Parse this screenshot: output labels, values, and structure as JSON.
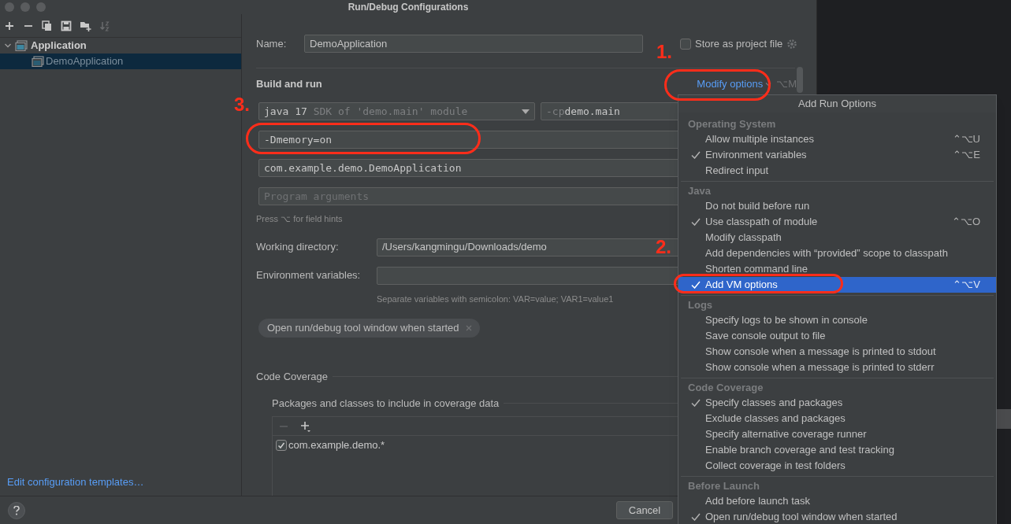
{
  "window": {
    "title": "Run/Debug Configurations"
  },
  "sidebar": {
    "tree": [
      {
        "label": "Application",
        "expanded": true,
        "selected": false,
        "children": [
          {
            "label": "DemoApplication",
            "selected": false,
            "highlighted": true
          }
        ]
      }
    ],
    "footer_link": "Edit configuration templates…"
  },
  "form": {
    "name_label": "Name:",
    "name_value": "DemoApplication",
    "store_as_project_file": {
      "label": "Store as project file",
      "checked": false
    },
    "section_title": "Build and run",
    "modify_options": {
      "label": "Modify options",
      "shortcut": "⌥M"
    },
    "jre": {
      "value": "java 17",
      "hint": "SDK of 'demo.main' module"
    },
    "classpath": {
      "prefix": "-cp",
      "value": "demo.main"
    },
    "vm_options": "-Dmemory=on",
    "main_class": "com.example.demo.DemoApplication",
    "program_arguments": {
      "placeholder": "Program arguments"
    },
    "field_hint": "Press ⌥ for field hints",
    "working_directory": {
      "label": "Working directory:",
      "value": "/Users/kangmingu/Downloads/demo"
    },
    "environment_variables": {
      "label": "Environment variables:",
      "hint": "Separate variables with semicolon: VAR=value; VAR1=value1"
    },
    "chips": [
      {
        "label": "Open run/debug tool window when started"
      }
    ],
    "code_coverage": {
      "title": "Code Coverage",
      "subtitle": "Packages and classes to include in coverage data",
      "patterns": [
        {
          "label": "com.example.demo.*",
          "checked": true
        }
      ]
    },
    "buttons": [
      {
        "label": "Cancel"
      }
    ]
  },
  "popup": {
    "title": "Add Run Options",
    "sections": [
      {
        "title": "Operating System",
        "items": [
          {
            "label": "Allow multiple instances",
            "checked": false,
            "selected": false,
            "shortcut": "⌃⌥U"
          },
          {
            "label": "Environment variables",
            "checked": true,
            "selected": false,
            "shortcut": "⌃⌥E"
          },
          {
            "label": "Redirect input",
            "checked": false,
            "selected": false
          }
        ]
      },
      {
        "title": "Java",
        "items": [
          {
            "label": "Do not build before run",
            "checked": false,
            "selected": false
          },
          {
            "label": "Use classpath of module",
            "checked": true,
            "selected": false,
            "shortcut": "⌃⌥O"
          },
          {
            "label": "Modify classpath",
            "checked": false,
            "selected": false
          },
          {
            "label": "Add dependencies with “provided” scope to classpath",
            "checked": false,
            "selected": false
          },
          {
            "label": "Shorten command line",
            "checked": false,
            "selected": false
          },
          {
            "label": "Add VM options",
            "checked": true,
            "selected": true,
            "shortcut": "⌃⌥V"
          }
        ]
      },
      {
        "title": "Logs",
        "items": [
          {
            "label": "Specify logs to be shown in console",
            "checked": false,
            "selected": false
          },
          {
            "label": "Save console output to file",
            "checked": false,
            "selected": false
          },
          {
            "label": "Show console when a message is printed to stdout",
            "checked": false,
            "selected": false
          },
          {
            "label": "Show console when a message is printed to stderr",
            "checked": false,
            "selected": false
          }
        ]
      },
      {
        "title": "Code Coverage",
        "items": [
          {
            "label": "Specify classes and packages",
            "checked": true,
            "selected": false
          },
          {
            "label": "Exclude classes and packages",
            "checked": false,
            "selected": false
          },
          {
            "label": "Specify alternative coverage runner",
            "checked": false,
            "selected": false
          },
          {
            "label": "Enable branch coverage and test tracking",
            "checked": false,
            "selected": false
          },
          {
            "label": "Collect coverage in test folders",
            "checked": false,
            "selected": false
          }
        ]
      },
      {
        "title": "Before Launch",
        "items": [
          {
            "label": "Add before launch task",
            "checked": false,
            "selected": false
          },
          {
            "label": "Open run/debug tool window when started",
            "checked": true,
            "selected": false
          }
        ]
      }
    ]
  },
  "annotations": [
    {
      "label": "1."
    },
    {
      "label": "2."
    },
    {
      "label": "3."
    }
  ]
}
